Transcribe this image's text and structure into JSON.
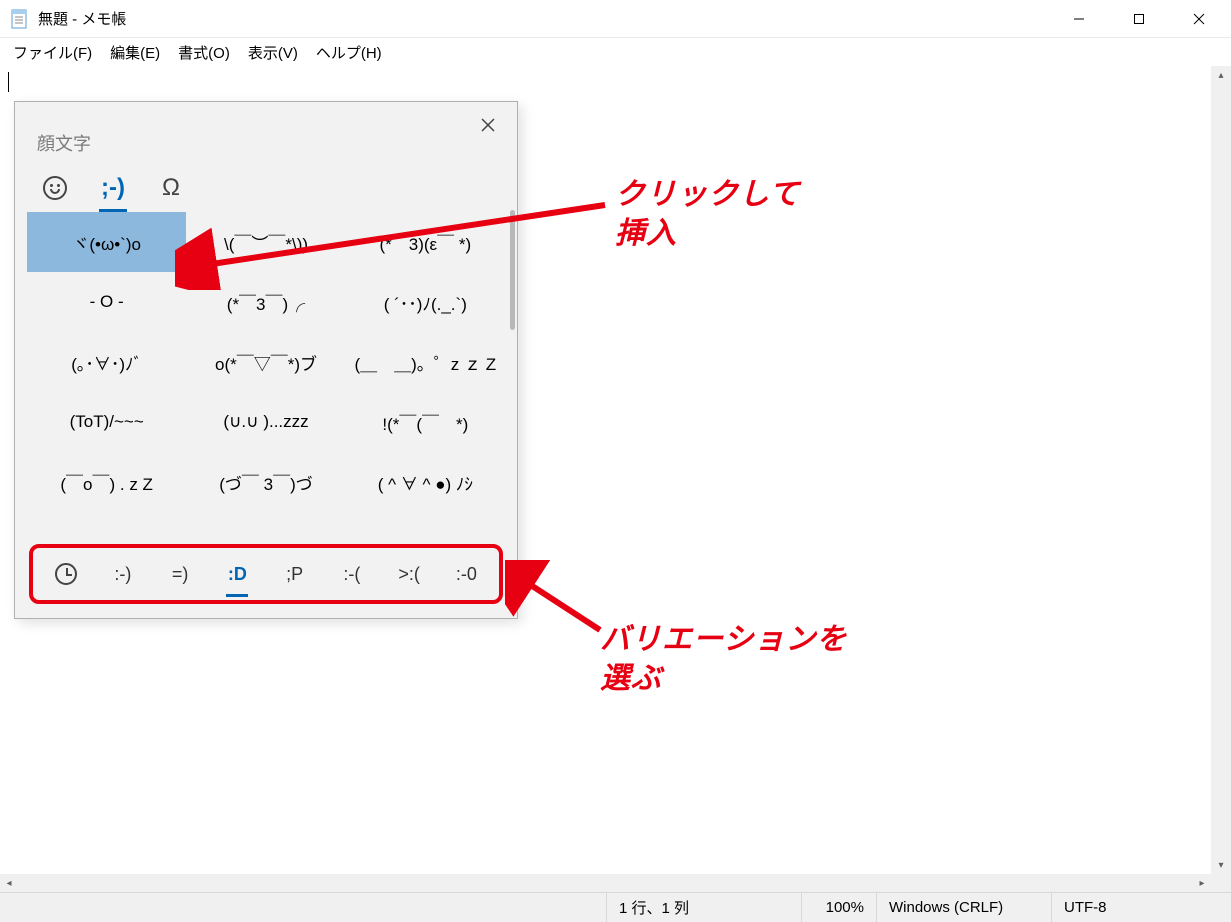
{
  "window": {
    "title": "無題 - メモ帳"
  },
  "menu": {
    "file": "ファイル(F)",
    "edit": "編集(E)",
    "format": "書式(O)",
    "view": "表示(V)",
    "help": "ヘルプ(H)"
  },
  "status": {
    "position": "1 行、1 列",
    "zoom": "100%",
    "line_ending": "Windows (CRLF)",
    "encoding": "UTF-8"
  },
  "emoji_panel": {
    "title": "顔文字",
    "tabs": {
      "smiley": "☺",
      "kaomoji": ";-)",
      "symbols": "Ω"
    },
    "grid": [
      "ヾ(•ω•`)o",
      "\\(￣︶￣*\\))",
      "(*￣3)(ε￣ *)",
      "- O -",
      "(*￣3￣)╭",
      "( ´･･)ﾉ(._.`)",
      "(｡･∀･)ﾉﾞ",
      "o(*￣▽￣*)ブ",
      "(＿　＿)。゜z ｚ Z",
      "(ToT)/~~~",
      "(∪.∪ )...zzz",
      "!(*￣(￣　*)",
      "(￣o￣) . z Z",
      "(づ￣ 3￣)づ",
      "( ^ ∀ ^ ●) ﾉｼ"
    ],
    "selected_index": 0,
    "variations": [
      ":-)",
      "=)",
      ":D",
      ";P",
      ":-(",
      ">:(",
      ":-0"
    ],
    "variation_selected_index": 2
  },
  "annotations": {
    "click_insert": "クリックして\n挿入",
    "choose_variation": "バリエーションを\n選ぶ"
  }
}
